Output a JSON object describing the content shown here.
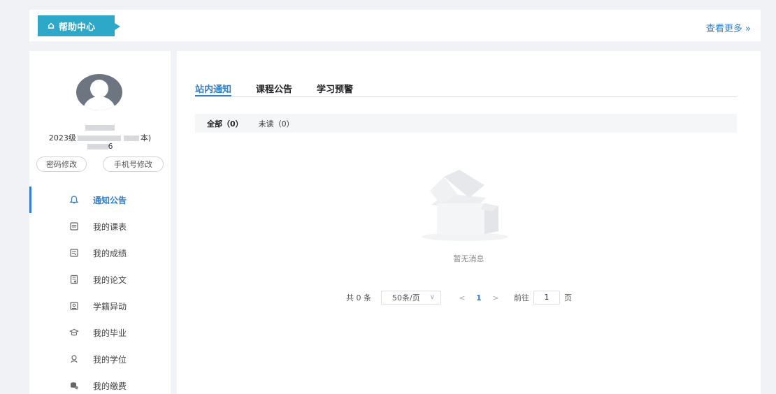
{
  "topbar": {
    "help_label": "帮助中心",
    "more_label": "查看更多 »"
  },
  "profile": {
    "class_prefix": "2023级",
    "class_suffix": "本)",
    "id_suffix": "6",
    "change_password": "密码修改",
    "change_phone": "手机号修改"
  },
  "nav": {
    "items": [
      {
        "label": "通知公告",
        "icon": "bell-icon"
      },
      {
        "label": "我的课表",
        "icon": "schedule-icon"
      },
      {
        "label": "我的成绩",
        "icon": "grades-icon"
      },
      {
        "label": "我的论文",
        "icon": "thesis-icon"
      },
      {
        "label": "学籍异动",
        "icon": "status-change-icon"
      },
      {
        "label": "我的毕业",
        "icon": "graduation-icon"
      },
      {
        "label": "我的学位",
        "icon": "degree-icon"
      },
      {
        "label": "我的缴费",
        "icon": "payment-icon"
      }
    ]
  },
  "tabs": [
    {
      "label": "站内通知"
    },
    {
      "label": "课程公告"
    },
    {
      "label": "学习预警"
    }
  ],
  "filter": {
    "all": "全部（0）",
    "unread": "未读（0）"
  },
  "empty_text": "暂无消息",
  "pagination": {
    "total": "共 0 条",
    "page_size": "50条/页",
    "current_page": "1",
    "goto_label": "前往",
    "goto_value": "1",
    "page_unit": "页"
  },
  "colors": {
    "accent": "#2f7fcf",
    "help_tag": "#2ea8c9"
  }
}
